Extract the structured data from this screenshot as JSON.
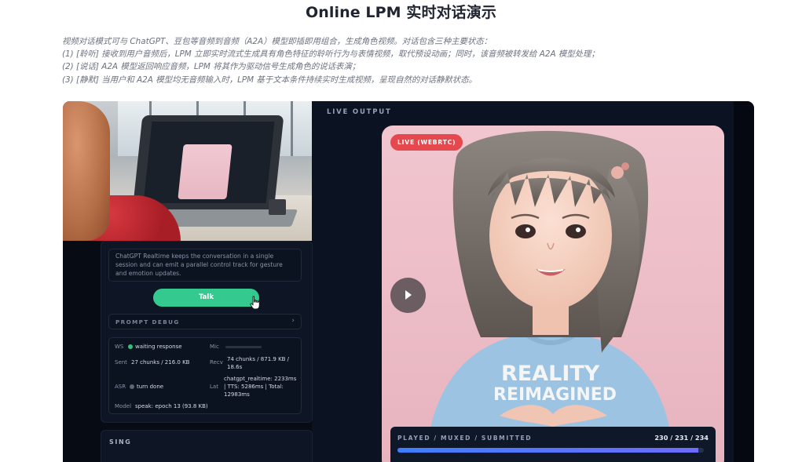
{
  "page": {
    "title": "Online LPM 实时对话演示",
    "description_lines": [
      "视频对话模式可与 ChatGPT、豆包等音频到音频（A2A）模型即插即用组合，生成角色视频。对话包含三种主要状态：",
      "(1) [聆听] 接收到用户音频后，LPM 立即实时流式生成具有角色特征的聆听行为与表情视频，取代预设动画；同时，该音频被转发给 A2A 模型处理；",
      "(2) [说话] A2A 模型返回响应音频，LPM 将其作为驱动信号生成角色的说话表演；",
      "(3) [静默] 当用户和 A2A 模型均无音频输入时，LPM 基于文本条件持续实时生成视频，呈现自然的对话静默状态。"
    ]
  },
  "demo": {
    "control_note": "ChatGPT Realtime keeps the conversation in a single session and can emit a parallel control track for gesture and emotion updates.",
    "talk_label": "Talk",
    "prompt_debug_label": "PROMPT DEBUG",
    "status": {
      "ws_label": "WS",
      "ws_value": "waiting response",
      "mic_label": "Mic",
      "sent_label": "Sent",
      "sent_value": "27 chunks / 216.0 KB",
      "recv_label": "Recv",
      "recv_value": "74 chunks / 871.9 KB / 18.6s",
      "asr_label": "ASR",
      "asr_value": "turn done",
      "lat_label": "Lat",
      "lat_value": "chatgpt_realtime: 2233ms | TTS: 5286ms | Total: 12983ms",
      "model_label": "Model",
      "model_value": "speak: epoch 13 (93.8 KB)"
    },
    "sing_label": "SING",
    "live_output_label": "LIVE OUTPUT",
    "live_badge": "LIVE (WEBRTC)",
    "shirt_text_line1": "REALITY",
    "shirt_text_line2": "REIMAGINED",
    "progress_label": "PLAYED / MUXED / SUBMITTED",
    "progress_count": "230 / 231 / 234",
    "progress_fraction": 0.983
  },
  "colors": {
    "accent_green": "#34c98f",
    "live_red": "#e5484d",
    "panel_bg": "#0b1322",
    "progress_blue": "#3f7dff"
  },
  "icons": [
    "chevron-right-icon",
    "hand-cursor-icon",
    "play-icon",
    "status-dot-icon"
  ]
}
